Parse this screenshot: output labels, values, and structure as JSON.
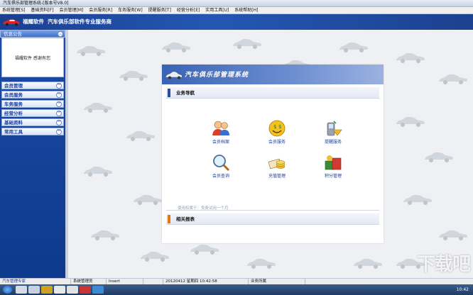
{
  "window": {
    "title": "汽车俱乐部管理系统-[版本号V8.0]"
  },
  "menu": [
    "系统管理[S]",
    "基础资料[F]",
    "会员管理[M]",
    "会员服务[R]",
    "车务服务[W]",
    "提醒服务[T]",
    "经营分析[E]",
    "实用工具[U]",
    "系统帮助[H]"
  ],
  "banner": {
    "brand": "福耀软件",
    "slogan": "汽车俱乐部软件专业服务商"
  },
  "sidebar": {
    "notice_title": "信息公告",
    "notice_text": "福耀软件 感谢有您",
    "items": [
      "会员管理",
      "会员服务",
      "车务服务",
      "经营分析",
      "基础资料",
      "常用工具"
    ]
  },
  "panel": {
    "title": "汽车俱乐部管理系统",
    "section_nav": "业务导航",
    "tiles": [
      {
        "label": "会员档案",
        "icon": "members-icon"
      },
      {
        "label": "会员服务",
        "icon": "money-face-icon"
      },
      {
        "label": "提醒服务",
        "icon": "phone-reminder-icon"
      },
      {
        "label": "会员查询",
        "icon": "search-magnifier-icon"
      },
      {
        "label": "充值管理",
        "icon": "recharge-icon"
      },
      {
        "label": "积分管理",
        "icon": "points-icon"
      }
    ],
    "copyright": "使用权属于：免费试用一个月",
    "section_reports": "相关报表"
  },
  "statusbar": {
    "app": "汽车管理专家",
    "user": "系统管理员",
    "mode": "Insert",
    "datetime": "20120412 星期四 10:42:58",
    "shop": "业务所属"
  },
  "taskbar": {
    "clock": "10:42"
  },
  "watermark": "下载吧",
  "colors": {
    "banner": "#2457b3",
    "sidebar": "#0d3a8c",
    "accent_orange": "#e07a10"
  }
}
